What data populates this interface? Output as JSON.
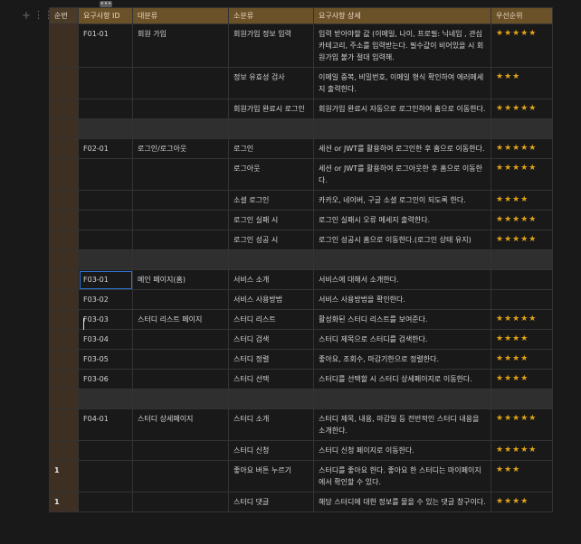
{
  "header": [
    "순번",
    "요구사항 ID",
    "대분류",
    "소분류",
    "요구사항 상세",
    "우선순위"
  ],
  "rows": [
    {
      "seq": "",
      "id": "F01-01",
      "major": "회원 가입",
      "minor": "회원가입 정보 입력",
      "detail": "입력 받아야할 값 (이메일, 나이, 프로필: 닉네임 , 관심 카테고리, 주소를 입력받는다. 필수값이 비어있을 시 회원가입 불가 절대 입력해.",
      "priority": "★★★★★"
    },
    {
      "seq": "",
      "id": "",
      "major": "",
      "minor": "정보 유효성 검사",
      "detail": "이메일 중복, 비밀번호, 이메일 형식 확인하여 에러메세지 출력한다.",
      "priority": "★★★"
    },
    {
      "seq": "",
      "id": "",
      "major": "",
      "minor": "회원가입 완료시 로그인",
      "detail": "회원가입 완료시 자동으로 로그인하여 홈으로 이동한다.",
      "priority": "★★★★★"
    },
    {
      "sep": true
    },
    {
      "seq": "",
      "id": "F02-01",
      "major": "로그인/로그아웃",
      "minor": "로그인",
      "detail": "세션 or JWT를 활용하여 로그인한 후 홈으로 이동한다.",
      "priority": "★★★★★"
    },
    {
      "seq": "",
      "id": "",
      "major": "",
      "minor": "로그아웃",
      "detail": "세션 or JWT를 활용하여 로그아웃한 후 홈으로 이동한다.",
      "priority": "★★★★★"
    },
    {
      "seq": "",
      "id": "",
      "major": "",
      "minor": "소셜 로그인",
      "detail": "카카오, 네이버, 구글 소셜 로그인이 되도록 한다.",
      "priority": "★★★★"
    },
    {
      "seq": "",
      "id": "",
      "major": "",
      "minor": "로그인 실패 시",
      "detail": "로그인 실패시 오류 메세지 출력한다.",
      "priority": "★★★★★"
    },
    {
      "seq": "",
      "id": "",
      "major": "",
      "minor": "로그인 성공 시",
      "detail": "로그인 성공시 홈으로 이동한다.(로그인 상태 유지)",
      "priority": "★★★★★"
    },
    {
      "sep": true
    },
    {
      "seq": "",
      "id": "F03-01",
      "major": "메인 페이지(홈)",
      "minor": "서비스 소개",
      "detail": "서비스에 대해서 소개한다.",
      "priority": "",
      "selected": true
    },
    {
      "seq": "",
      "id": "F03-02",
      "major": "",
      "minor": "서비스 사용방법",
      "detail": "서비스 사용방법을 확인한다.",
      "priority": ""
    },
    {
      "seq": "",
      "id": "F03-03",
      "major": "스터디 리스트 페이지",
      "minor": "스터디 리스트",
      "detail": "활성화된 스터디 리스트를 보여준다.",
      "priority": "★★★★★"
    },
    {
      "seq": "",
      "id": "F03-04",
      "major": "",
      "minor": "스터디 검색",
      "detail": "스터디 제목으로 스터디를 검색한다.",
      "priority": "★★★★"
    },
    {
      "seq": "",
      "id": "F03-05",
      "major": "",
      "minor": "스터디 정렬",
      "detail": "좋아요, 조회수, 마감기한으로 정렬한다.",
      "priority": "★★★★"
    },
    {
      "seq": "",
      "id": "F03-06",
      "major": "",
      "minor": "스터디 선택",
      "detail": "스터디를 선택할 시 스터디 상세페이지로 이동한다.",
      "priority": "★★★★"
    },
    {
      "sep": true
    },
    {
      "seq": "",
      "id": "F04-01",
      "major": "스터디 상세페이지",
      "minor": "스터디 소개",
      "detail": "스터디 제목, 내용, 마감일 등 전반적인 스터디 내용을 소개한다.",
      "priority": "★★★★★"
    },
    {
      "seq": "",
      "id": "",
      "major": "",
      "minor": "스터디 신청",
      "detail": "스터디 신청 페이지로 이동한다.",
      "priority": "★★★★★"
    },
    {
      "seq": "1",
      "id": "",
      "major": "",
      "minor": "좋아요 버튼 누르기",
      "detail": "스터디를 좋아요 한다. 좋아요 한 스터디는 마이페이지에서 확인할 수 있다.",
      "priority": "★★★"
    },
    {
      "seq": "1",
      "id": "",
      "major": "",
      "minor": "스터디 댓글",
      "detail": "해당 스터디에 대한 정보를 물을 수 있는 댓글 창구이다.",
      "priority": "★★★★"
    }
  ],
  "controls": {
    "add": "+",
    "drag": "⋮⋮",
    "col_handle": "•••",
    "row_handle": "⋮"
  },
  "colors": {
    "header": "#6b5128",
    "first_col": "#3d2f22",
    "separator": "#2f2f2f",
    "star": "#e0a21a",
    "selection": "#2f73d6"
  }
}
